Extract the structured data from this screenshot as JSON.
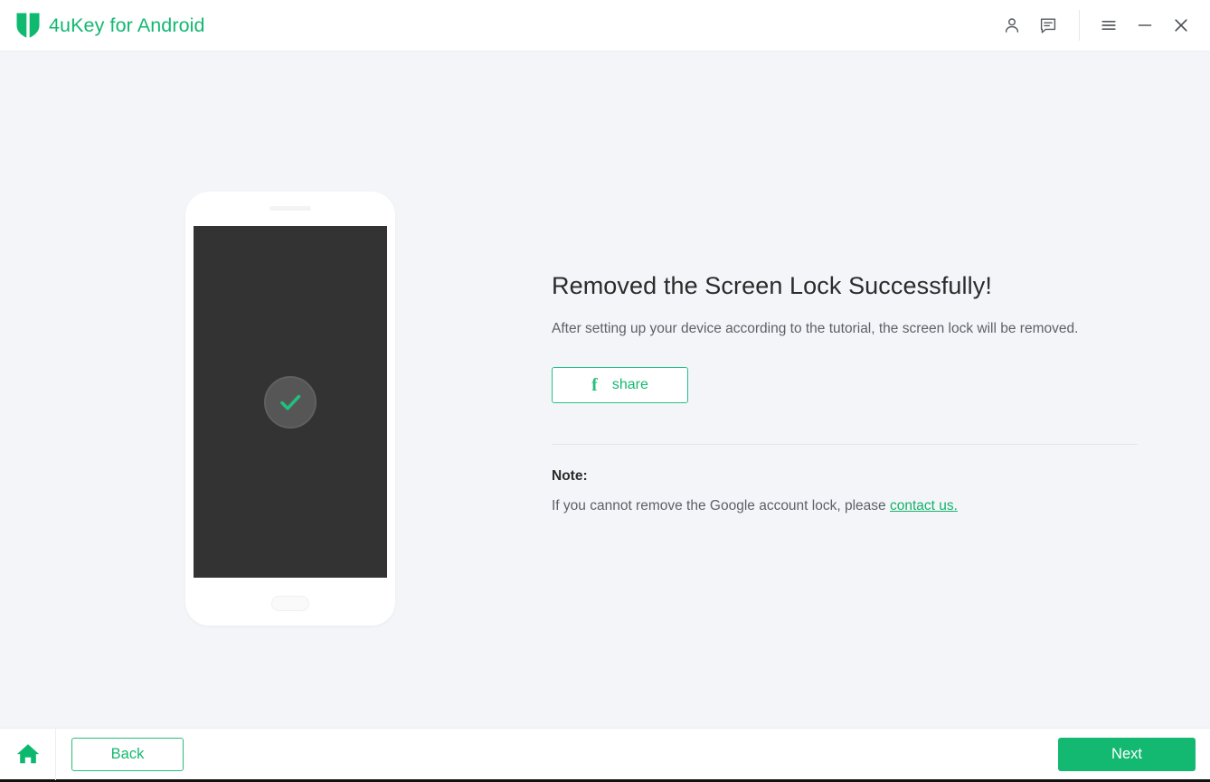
{
  "window": {
    "title": "4uKey for Android",
    "logo_icon": "shield-logo-icon",
    "brand_color": "#13b871",
    "background_color": "#f4f5f9",
    "controls": [
      {
        "name": "account-icon",
        "label": "Account"
      },
      {
        "name": "feedback-icon",
        "label": "Feedback"
      },
      {
        "name": "menu-icon",
        "label": "Menu"
      },
      {
        "name": "minimize-icon",
        "label": "Minimize"
      },
      {
        "name": "close-icon",
        "label": "Close"
      }
    ]
  },
  "illustration": {
    "device": "android-phone",
    "screen_color": "#333333",
    "status_icon": "check-circle-icon",
    "check_color": "#21c07d"
  },
  "main": {
    "headline": "Removed the Screen Lock Successfully!",
    "description": "After setting up your device according to the tutorial, the screen lock will be removed.",
    "share_button": {
      "label": "share",
      "icon": "facebook-f-icon"
    },
    "note": {
      "label": "Note:",
      "text_before_link": "If you cannot remove the Google account lock, please ",
      "link_text": "contact us.",
      "link_color": "#14b26c"
    }
  },
  "footer": {
    "home_icon": "home-icon",
    "back_label": "Back",
    "next_label": "Next",
    "next_color": "#13b871"
  }
}
